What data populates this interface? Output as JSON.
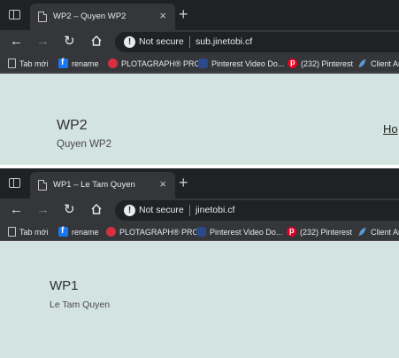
{
  "windows": [
    {
      "tab_title": "WP2 – Quyen WP2",
      "security_label": "Not secure",
      "url": "sub.jinetobi.cf",
      "site_title": "WP2",
      "site_description": "Quyen WP2",
      "nav_link": "Ho"
    },
    {
      "tab_title": "WP1 – Le Tam Quyen",
      "security_label": "Not secure",
      "url": "jinetobi.cf",
      "site_title": "WP1",
      "site_description": "Le Tam Quyen"
    }
  ],
  "bookmarks": [
    {
      "label": "Tab mới",
      "icon": "page-icon"
    },
    {
      "label": "rename",
      "icon": "facebook-icon"
    },
    {
      "label": "PLOTAGRAPH® PRO",
      "icon": "plotagraph-icon"
    },
    {
      "label": "Pinterest Video Do...",
      "icon": "pinterest-video-icon"
    },
    {
      "label": "(232) Pinterest",
      "icon": "pinterest-icon"
    },
    {
      "label": "Client Ar",
      "icon": "feather-icon"
    }
  ],
  "icons": {
    "close": "×",
    "new_tab": "+",
    "back": "←",
    "forward": "→",
    "reload": "↻",
    "warning": "!"
  },
  "colors": {
    "page_background": "#d3e3e0",
    "browser_chrome": "#35363a"
  }
}
